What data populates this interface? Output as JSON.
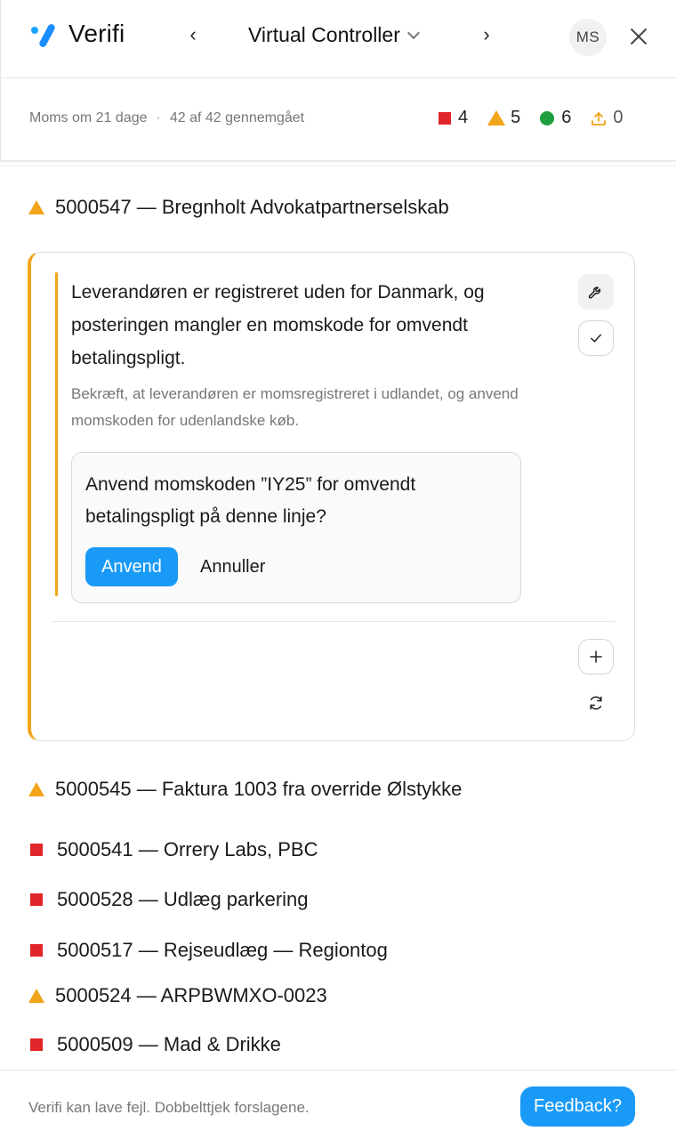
{
  "header": {
    "brand": "Verifi",
    "title": "Virtual Controller",
    "prev_icon": "‹",
    "next_icon": "›",
    "avatar_initials": "MS"
  },
  "status": {
    "due_text": "Moms om 21 dage",
    "separator": "·",
    "reviewed_text": "42 af 42 gennemgået",
    "counts": {
      "errors": "4",
      "warnings": "5",
      "ok": "6",
      "uploads": "0"
    }
  },
  "expanded_item": {
    "label": "5000547 — Bregnholt Advokatpartnerselskab",
    "severity": "warning",
    "message": "Leverandøren er registreret uden for Danmark, og posteringen mangler en momskode for omvendt betalingspligt.",
    "hint": "Bekræft, at leverandøren er momsregistreret i udlandet, og anvend momskoden for udenlandske køb.",
    "confirm_question": "Anvend momskoden ”IY25” for omvendt betalingspligt på denne linje?",
    "apply_label": "Anvend",
    "cancel_label": "Annuller"
  },
  "items": [
    {
      "label": "5000545 — Faktura 1003 fra override Ølstykke",
      "severity": "warning"
    },
    {
      "label": "5000541 — Orrery Labs, PBC",
      "severity": "error"
    },
    {
      "label": "5000528 — Udlæg parkering",
      "severity": "error"
    },
    {
      "label": "5000517 — Rejseudlæg — Regiontog",
      "severity": "error"
    },
    {
      "label": "5000524 — ARPBWMXO-0023",
      "severity": "warning"
    },
    {
      "label": "5000509 — Mad & Drikke",
      "severity": "error"
    }
  ],
  "footer": {
    "disclaimer": "Verifi kan lave fejl. Dobbelttjek forslagene.",
    "feedback_label": "Feedback?"
  },
  "colors": {
    "accent": "#1a9af7",
    "warning": "#f2a41a",
    "error": "#e0262a",
    "ok": "#1e9e3c"
  }
}
